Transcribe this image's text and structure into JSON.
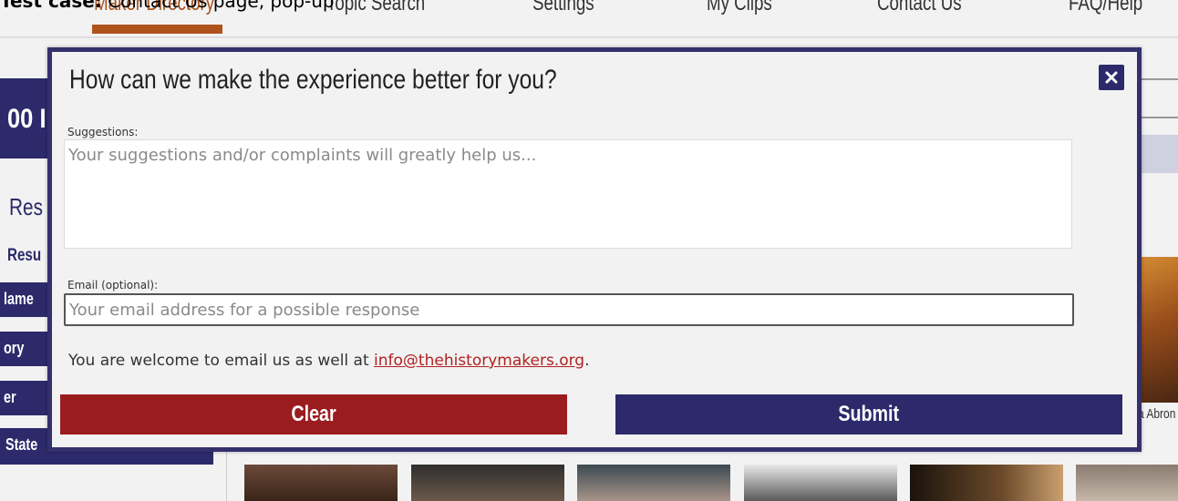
{
  "caption": {
    "prefix": "Test case:",
    "text": " Contact Us page, pop-up"
  },
  "nav": {
    "items": [
      {
        "label": "Maker Directory",
        "active": true
      },
      {
        "label": "Topic Search"
      },
      {
        "label": "Settings"
      },
      {
        "label": "My Clips"
      },
      {
        "label": "Contact Us"
      },
      {
        "label": "FAQ/Help"
      }
    ]
  },
  "background": {
    "banner_fragment": "00 I",
    "results_heading": "Res",
    "results_sub": "Resu",
    "side_items": [
      "lame",
      "ory",
      "er"
    ],
    "state_label": "State",
    "portrait_label": "a Abron"
  },
  "modal": {
    "title": "How can we make the experience better for you?",
    "suggestions_label": "Suggestions:",
    "suggestions_placeholder": "Your suggestions and/or complaints will greatly help us...",
    "email_label": "Email (optional):",
    "email_placeholder": "Your email address for a possible response",
    "note_prefix": "You are welcome to email us as well at ",
    "note_email": "info@thehistorymakers.org",
    "note_suffix": ".",
    "clear_label": "Clear",
    "submit_label": "Submit"
  },
  "colors": {
    "brand_purple": "#2c2a6b",
    "clear_red": "#9b1c1f",
    "link_red": "#b22222",
    "nav_active": "#b0521c"
  },
  "icons": {
    "close": "close-icon"
  }
}
